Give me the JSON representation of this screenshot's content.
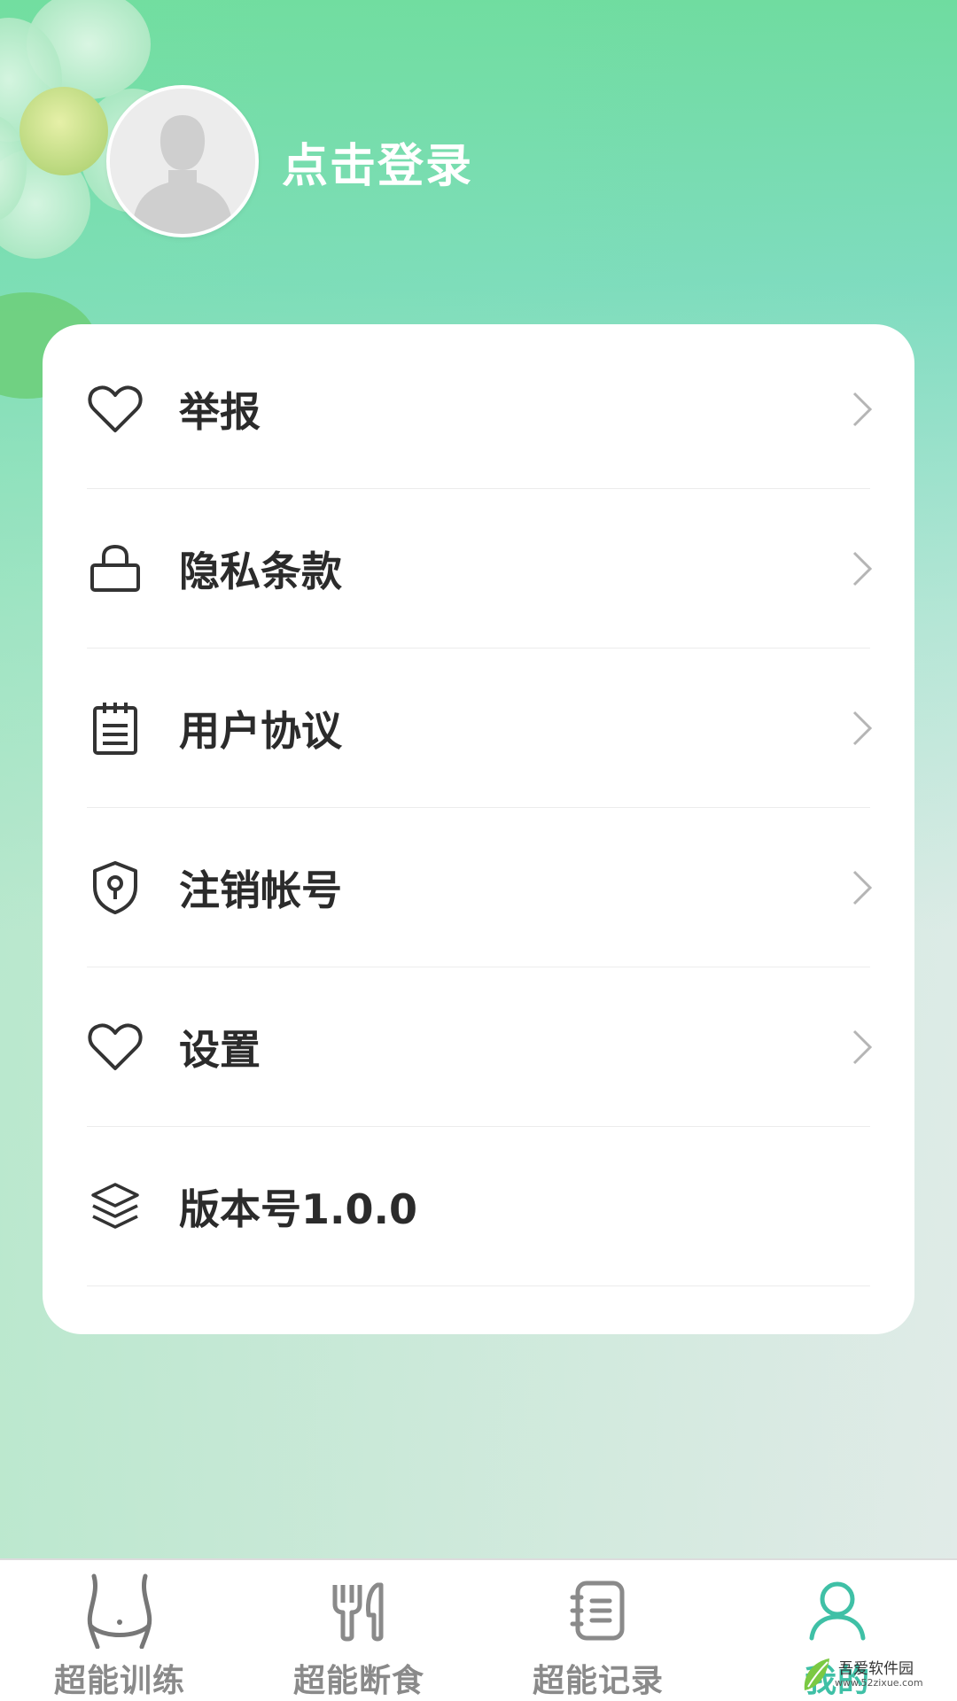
{
  "profile": {
    "login_label": "点击登录"
  },
  "menu": [
    {
      "label": "举报",
      "icon": "heart-icon"
    },
    {
      "label": "隐私条款",
      "icon": "lock-icon"
    },
    {
      "label": "用户协议",
      "icon": "notepad-icon"
    },
    {
      "label": "注销帐号",
      "icon": "shield-key-icon"
    },
    {
      "label": "设置",
      "icon": "heart-icon"
    },
    {
      "label": "版本号1.0.0",
      "icon": "layers-icon"
    }
  ],
  "tabs": [
    {
      "label": "超能训练",
      "icon": "waist-icon",
      "active": false
    },
    {
      "label": "超能断食",
      "icon": "fork-knife-icon",
      "active": false
    },
    {
      "label": "超能记录",
      "icon": "notebook-icon",
      "active": false
    },
    {
      "label": "我的",
      "icon": "person-icon",
      "active": true
    }
  ],
  "watermark": {
    "title": "吾爱软件园",
    "url": "www.52zixue.com"
  },
  "colors": {
    "accent": "#3fc0a6",
    "text_dark": "#2b2b2b",
    "tab_inactive": "#8a8a8a",
    "card_bg": "#ffffff"
  }
}
